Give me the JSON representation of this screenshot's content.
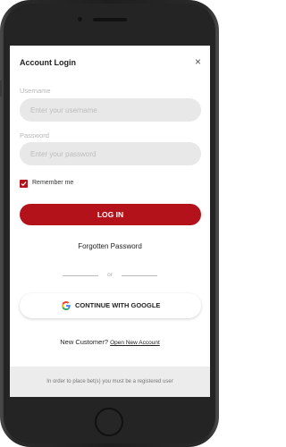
{
  "modal": {
    "title": "Account Login",
    "close_glyph": "×"
  },
  "form": {
    "username_label": "Username",
    "username_placeholder": "Enter your username",
    "password_label": "Password",
    "password_placeholder": "Enter your password",
    "remember_label": "Remember me",
    "remember_checked": true,
    "login_button": "LOG IN",
    "forgot_link": "Forgotten Password",
    "divider_text": "or",
    "google_button": "CONTINUE WITH GOOGLE"
  },
  "signup": {
    "prompt": "New Customer?",
    "link": "Open New Account"
  },
  "footer": {
    "notice": "In order to place bet(s) you must be a registered user"
  },
  "colors": {
    "accent": "#b3121b",
    "input_bg": "#e8e8e8",
    "footer_bg": "#ececec"
  },
  "icons": {
    "close": "close-icon",
    "checkbox": "checkmark-icon",
    "google": "google-icon"
  }
}
